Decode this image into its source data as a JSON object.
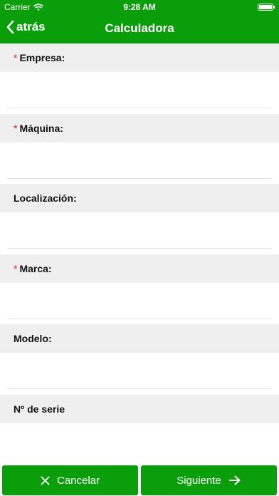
{
  "status_bar": {
    "carrier": "Carrier",
    "time": "9:28 AM"
  },
  "nav": {
    "back_label": "atrás",
    "title": "Calculadora"
  },
  "fields": [
    {
      "label": "Empresa:",
      "required": true,
      "value": ""
    },
    {
      "label": "Máquina:",
      "required": true,
      "value": ""
    },
    {
      "label": "Localización:",
      "required": false,
      "value": ""
    },
    {
      "label": "Marca:",
      "required": true,
      "value": ""
    },
    {
      "label": "Modelo:",
      "required": false,
      "value": ""
    },
    {
      "label": "Nº de serie",
      "required": false,
      "value": ""
    }
  ],
  "required_marker": "*",
  "buttons": {
    "cancel_label": "Cancelar",
    "next_label": "Siguiente"
  },
  "colors": {
    "brand_green": "#0a9e0a",
    "label_background": "#efefef",
    "required_marker": "#e02020"
  },
  "icons": [
    "wifi-icon",
    "battery-icon",
    "chevron-left-icon",
    "close-icon",
    "arrow-right-icon"
  ]
}
